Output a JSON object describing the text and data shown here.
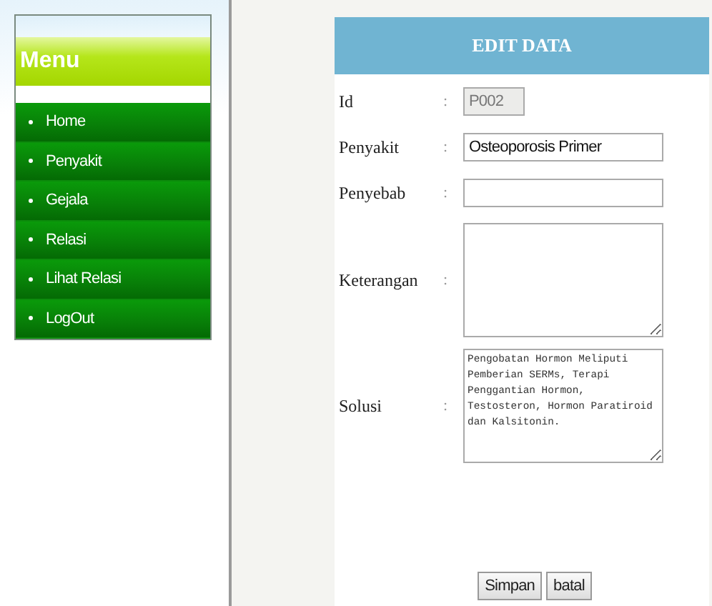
{
  "sidebar": {
    "title": "Menu",
    "items": [
      {
        "label": "Home"
      },
      {
        "label": "Penyakit"
      },
      {
        "label": "Gejala"
      },
      {
        "label": "Relasi"
      },
      {
        "label": "Lihat Relasi"
      },
      {
        "label": "LogOut"
      }
    ]
  },
  "form": {
    "title": "EDIT DATA",
    "fields": [
      {
        "label": "Id",
        "kind": "text",
        "value": "P002",
        "disabled": true
      },
      {
        "label": "Penyakit",
        "kind": "text",
        "value": "Osteoporosis Primer",
        "disabled": false
      },
      {
        "label": "Penyebab",
        "kind": "text",
        "disabled": false
      },
      {
        "label": "Keterangan",
        "kind": "textarea",
        "disabled": false
      },
      {
        "label": "Solusi",
        "kind": "textarea",
        "value": "Pengobatan Hormon Meliputi Pemberian SERMs, Terapi Penggantian Hormon, Testosteron, Hormon Paratiroid dan Kalsitonin.",
        "disabled": false
      }
    ],
    "separator": ":",
    "buttons": [
      "Simpan",
      "batal"
    ]
  }
}
